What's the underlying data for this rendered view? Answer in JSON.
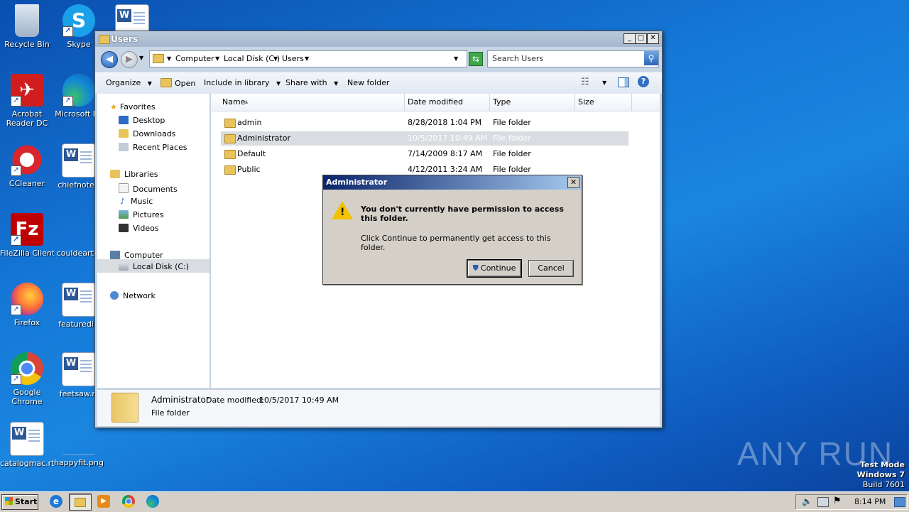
{
  "desktop": {
    "icons": [
      {
        "label": "Recycle Bin"
      },
      {
        "label": "Skype"
      },
      {
        "label": "Acrobat\nReader DC"
      },
      {
        "label": "Microsoft Ed"
      },
      {
        "label": "CCleaner"
      },
      {
        "label": "chiefnote.r"
      },
      {
        "label": "FileZilla Client"
      },
      {
        "label": "couldearth."
      },
      {
        "label": "Firefox"
      },
      {
        "label": "featuredi.r"
      },
      {
        "label": "Google\nChrome"
      },
      {
        "label": "feetsaw.rt"
      },
      {
        "label": "catalogmac.rtf"
      },
      {
        "label": "happyfit.png"
      }
    ],
    "watermark": "ANY RUN",
    "test_mode": [
      "Test Mode",
      "Windows 7",
      "Build 7601"
    ]
  },
  "explorer": {
    "title": "Users",
    "breadcrumb": [
      "Computer",
      "Local Disk (C:)",
      "Users"
    ],
    "search_placeholder": "Search Users",
    "toolbar": {
      "organize": "Organize",
      "open": "Open",
      "include": "Include in library",
      "share": "Share with",
      "new_folder": "New folder"
    },
    "nav": {
      "favorites": "Favorites",
      "desktop": "Desktop",
      "downloads": "Downloads",
      "recent": "Recent Places",
      "libraries": "Libraries",
      "documents": "Documents",
      "music": "Music",
      "pictures": "Pictures",
      "videos": "Videos",
      "computer": "Computer",
      "local_disk": "Local Disk (C:)",
      "network": "Network"
    },
    "columns": [
      "Name",
      "Date modified",
      "Type",
      "Size"
    ],
    "rows": [
      {
        "name": "admin",
        "date": "8/28/2018 1:04 PM",
        "type": "File folder"
      },
      {
        "name": "Administrator",
        "date": "10/5/2017 10:49 AM",
        "type": "File folder"
      },
      {
        "name": "Default",
        "date": "7/14/2009 8:17 AM",
        "type": "File folder"
      },
      {
        "name": "Public",
        "date": "4/12/2011 3:24 AM",
        "type": "File folder"
      }
    ],
    "details": {
      "name": "Administrator",
      "modified_label": "Date modified:",
      "modified": "10/5/2017 10:49 AM",
      "type": "File folder"
    }
  },
  "dialog": {
    "title": "Administrator",
    "heading": "You don't currently have permission to access this folder.",
    "message": "Click Continue to permanently get access to this folder.",
    "continue": "Continue",
    "cancel": "Cancel"
  },
  "taskbar": {
    "start": "Start",
    "time": "8:14 PM"
  }
}
